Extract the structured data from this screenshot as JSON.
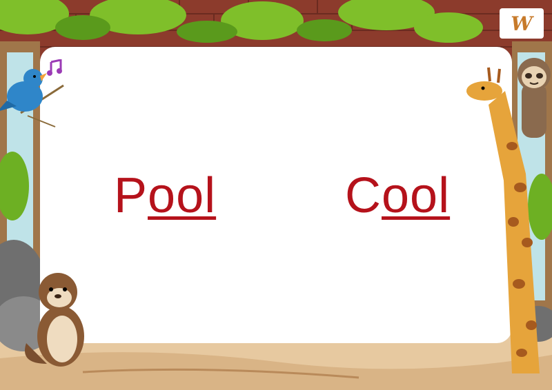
{
  "colors": {
    "word": "#b5121b",
    "brick": "#8c3b2c",
    "sand": "#e7c9a0",
    "leaf": "#7fbf2a",
    "card": "#ffffff"
  },
  "words": [
    {
      "prefix": "P",
      "underlined": "ool"
    },
    {
      "prefix": "C",
      "underlined": "ool"
    }
  ],
  "logo": {
    "text": "W"
  },
  "icons": {
    "music": "music-note-icon",
    "bird": "bird-icon",
    "giraffe": "giraffe-icon",
    "sloth": "sloth-icon",
    "otter": "otter-icon",
    "logo": "logo-icon"
  }
}
